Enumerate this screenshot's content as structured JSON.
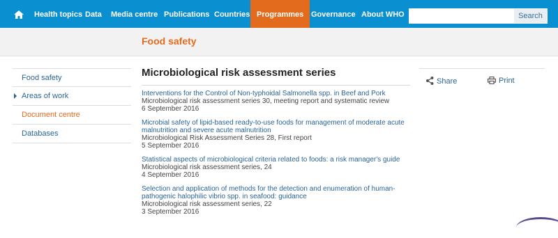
{
  "topnav": {
    "home_icon": "home-icon",
    "items": [
      {
        "label": "Health topics"
      },
      {
        "label": "Data"
      },
      {
        "label": "Media centre"
      },
      {
        "label": "Publications"
      },
      {
        "label": "Countries"
      },
      {
        "label": "Programmes",
        "active": true
      },
      {
        "label": "Governance"
      },
      {
        "label": "About WHO"
      }
    ],
    "search": {
      "placeholder": "",
      "button_label": "Search"
    },
    "colors": {
      "bar": "#0a8fd0",
      "active": "#e36b1e"
    }
  },
  "banner": {
    "title": "Food safety"
  },
  "leftnav": {
    "items": [
      {
        "label": "Food safety"
      },
      {
        "label": "Areas of work",
        "expandable": true
      },
      {
        "label": "Document centre",
        "current": true
      },
      {
        "label": "Databases"
      }
    ]
  },
  "main": {
    "title": "Microbiological risk assessment series",
    "documents": [
      {
        "title": "Interventions for the Control of Non-typhoidal Salmonella spp. in Beef and Pork",
        "series": "Microbiological risk assessment series 30, meeting report and systematic review",
        "date": "6 September 2016"
      },
      {
        "title": "Microbial safety of lipid-based ready-to-use foods for management of moderate acute malnutrition and severe acute malnutrition",
        "series": "Microbiological Risk Assessment Series 28, First report",
        "date": "5 September 2016"
      },
      {
        "title": "Statistical aspects of microbiological criteria related to foods: a risk manager's guide",
        "series": "Microbiological risk assessment series, 24",
        "date": "4 September 2016"
      },
      {
        "title": "Selection and application of methods for the detection and enumeration of human-pathogenic halophilic vibrio spp. in seafood: guidance",
        "series": "Microbiological risk assessment series, 22",
        "date": "3 September 2016"
      }
    ]
  },
  "sidebar": {
    "share_label": "Share",
    "print_label": "Print"
  }
}
